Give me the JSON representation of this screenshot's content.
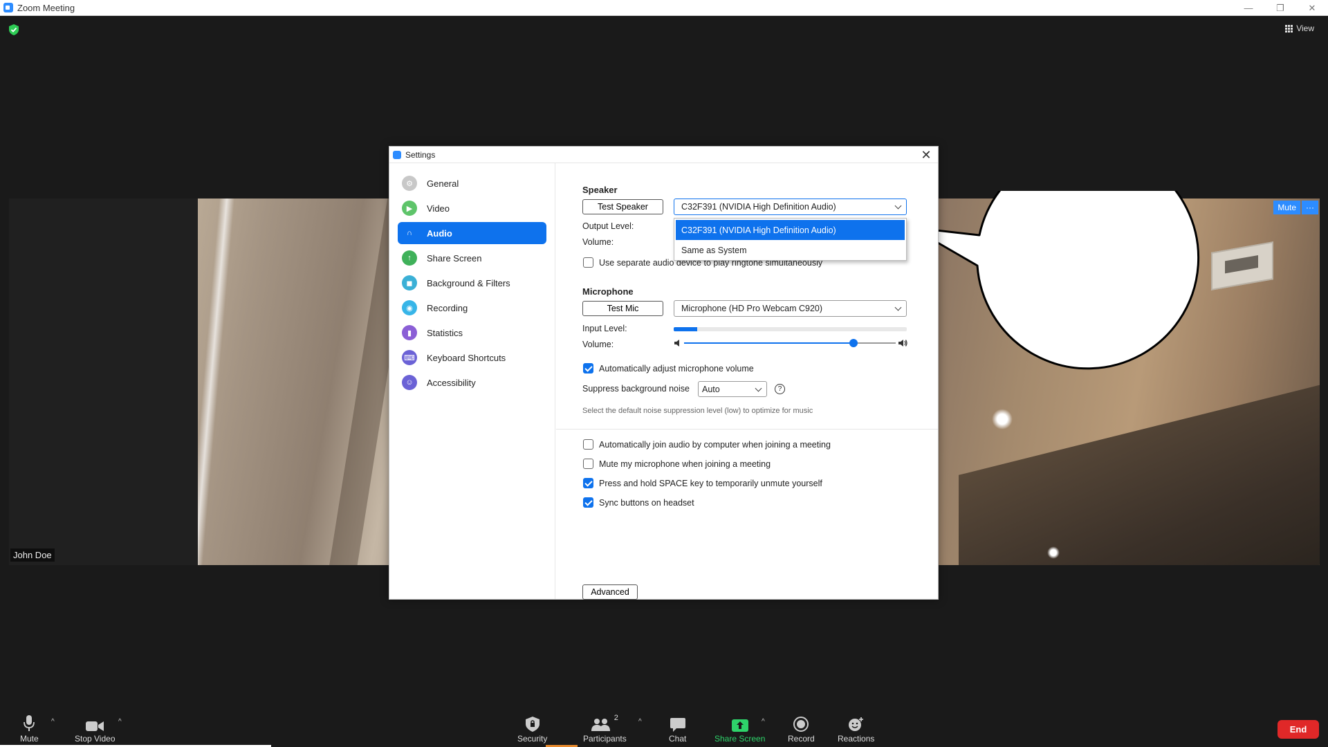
{
  "window": {
    "title": "Zoom Meeting",
    "min": "—",
    "restore": "❐",
    "close": "✕"
  },
  "view": {
    "label": "View"
  },
  "participant": {
    "name": "John Doe"
  },
  "tile_controls": {
    "mute": "Mute",
    "more": "···"
  },
  "settings": {
    "title": "Settings",
    "close": "✕",
    "nav": [
      {
        "label": "General",
        "icon": "gear-icon",
        "color": "#c8c8c8"
      },
      {
        "label": "Video",
        "icon": "video-icon",
        "color": "#5ec46a"
      },
      {
        "label": "Audio",
        "icon": "headphones-icon",
        "color": "#0e72ed",
        "active": true
      },
      {
        "label": "Share Screen",
        "icon": "share-screen-icon",
        "color": "#3fb15a"
      },
      {
        "label": "Background & Filters",
        "icon": "background-icon",
        "color": "#3bb0d6"
      },
      {
        "label": "Recording",
        "icon": "recording-icon",
        "color": "#37b5e8"
      },
      {
        "label": "Statistics",
        "icon": "statistics-icon",
        "color": "#8b5fd6"
      },
      {
        "label": "Keyboard Shortcuts",
        "icon": "keyboard-icon",
        "color": "#6b62d6"
      },
      {
        "label": "Accessibility",
        "icon": "accessibility-icon",
        "color": "#6b62d6"
      }
    ],
    "speaker": {
      "title": "Speaker",
      "test_button": "Test Speaker",
      "device": "C32F391 (NVIDIA High Definition Audio)",
      "output_level_label": "Output Level:",
      "volume_label": "Volume:",
      "options": [
        "C32F391 (NVIDIA High Definition Audio)",
        "Same as System"
      ],
      "separate_ringtone": {
        "label": "Use separate audio device to play ringtone simultaneously",
        "checked": false
      }
    },
    "microphone": {
      "title": "Microphone",
      "test_button": "Test Mic",
      "device": "Microphone (HD Pro Webcam C920)",
      "input_level_label": "Input Level:",
      "input_level": 0.1,
      "volume_label": "Volume:",
      "volume": 0.8,
      "auto_adjust": {
        "label": "Automatically adjust microphone volume",
        "checked": true
      },
      "suppress_label": "Suppress background noise",
      "suppress_value": "Auto",
      "suppress_hint": "Select the default noise suppression level (low) to optimize for music"
    },
    "options": [
      {
        "label": "Automatically join audio by computer when joining a meeting",
        "checked": false
      },
      {
        "label": "Mute my microphone when joining a meeting",
        "checked": false
      },
      {
        "label": "Press and hold SPACE key to temporarily unmute yourself",
        "checked": true
      },
      {
        "label": "Sync buttons on headset",
        "checked": true
      }
    ],
    "advanced_button": "Advanced"
  },
  "toolbar": {
    "mute": "Mute",
    "stop_video": "Stop Video",
    "security": "Security",
    "participants": "Participants",
    "participant_count": "2",
    "chat": "Chat",
    "share_screen": "Share Screen",
    "record": "Record",
    "reactions": "Reactions",
    "end": "End"
  },
  "colors": {
    "accent": "#0e72ed",
    "share": "#2ed36a",
    "end": "#e02828"
  }
}
